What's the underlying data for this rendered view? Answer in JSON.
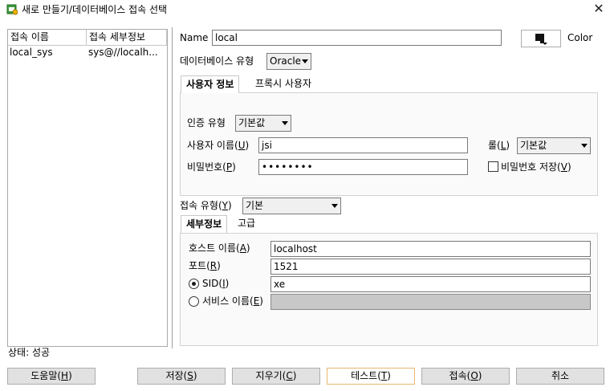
{
  "window": {
    "title": "새로 만들기/데이터베이스 접속 선택",
    "close_glyph": "✕"
  },
  "connections": {
    "columns": [
      "접속 이름",
      "접속 세부정보"
    ],
    "rows": [
      {
        "name": "local_sys",
        "details": "sys@//localh..."
      }
    ]
  },
  "form": {
    "name_label": "Name",
    "name_value": "local",
    "color_label": "Color",
    "dbtype_label": "데이터베이스 유형",
    "dbtype_value": "Oracle",
    "tabs": [
      "사용자 정보",
      "프록시 사용자"
    ],
    "auth": {
      "auth_type_label": "인증 유형",
      "auth_type_value": "기본값",
      "username_label": "사용자 이름(",
      "username_key": "U",
      "username_value": "jsi",
      "role_label": "롤(",
      "role_key": "L",
      "role_value": "기본값",
      "password_label": "비밀번호(",
      "password_key": "P",
      "password_value": "••••••••",
      "save_password_label": "비밀번호 저장(",
      "save_password_key": "V",
      "save_password_checked": false
    },
    "conn_type_label": "접속 유형(",
    "conn_type_key": "Y",
    "conn_type_value": "기본",
    "detail_tabs": [
      "세부정보",
      "고급"
    ],
    "details": {
      "host_label": "호스트 이름(",
      "host_key": "A",
      "host_value": "localhost",
      "port_label": "포트(",
      "port_key": "R",
      "port_value": "1521",
      "sid_label": "SID(",
      "sid_key": "I",
      "sid_value": "xe",
      "service_label": "서비스 이름(",
      "service_key": "E",
      "service_value": "",
      "selected": "SID"
    }
  },
  "status": {
    "text": "상태: 성공"
  },
  "buttons": {
    "help": {
      "label": "도움말(",
      "key": "H"
    },
    "save": {
      "label": "저장(",
      "key": "S"
    },
    "clear": {
      "label": "지우기(",
      "key": "C"
    },
    "test": {
      "label": "테스트(",
      "key": "T"
    },
    "connect": {
      "label": "접속(",
      "key": "O"
    },
    "cancel": {
      "label": "취소"
    }
  }
}
